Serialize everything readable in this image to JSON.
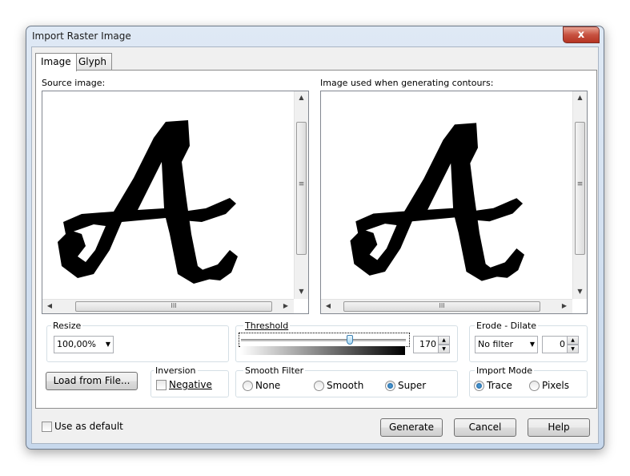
{
  "window": {
    "title": "Import Raster Image",
    "close_glyph": "x"
  },
  "tabs": [
    {
      "label": "Image",
      "active": true
    },
    {
      "label": "Glyph",
      "active": false
    }
  ],
  "panes": {
    "source_label": "Source image:",
    "output_label": "Image used when generating contours:"
  },
  "scroll": {
    "up": "▲",
    "down": "▼",
    "left": "◀",
    "right": "▶",
    "grip_v": "≡",
    "grip_h": "III"
  },
  "resize": {
    "label": "Resize",
    "value": "100,00%"
  },
  "threshold": {
    "label": "Threshold",
    "value": "170",
    "slider_fraction": 0.66
  },
  "erode_dilate": {
    "label": "Erode - Dilate",
    "filter_value": "No filter",
    "amount": "0"
  },
  "load_button": "Load from File...",
  "inversion": {
    "label": "Inversion",
    "negative_label": "Negative",
    "negative_checked": false
  },
  "smooth_filter": {
    "label": "Smooth Filter",
    "options": [
      "None",
      "Smooth",
      "Super"
    ],
    "selected": "Super"
  },
  "import_mode": {
    "label": "Import Mode",
    "options": [
      "Trace",
      "Pixels"
    ],
    "selected": "Trace"
  },
  "use_as_default": {
    "label": "Use as default",
    "checked": false
  },
  "buttons": {
    "generate": "Generate",
    "cancel": "Cancel",
    "help": "Help"
  },
  "glyph_letter": "A",
  "combo_arrow": "▼"
}
